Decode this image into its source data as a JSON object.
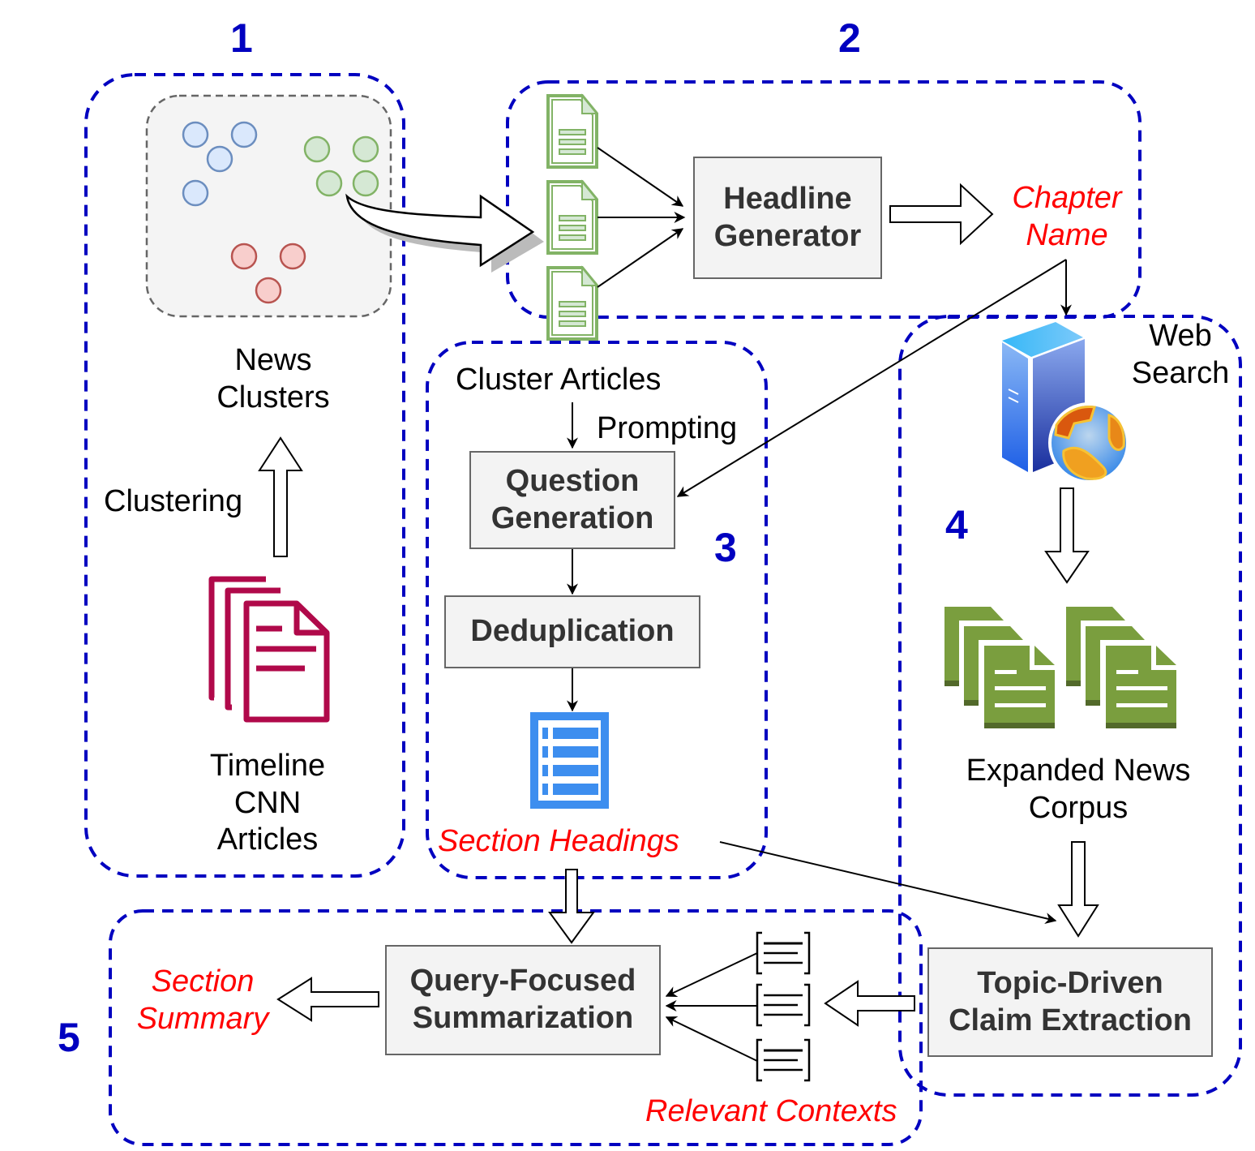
{
  "diagram": {
    "type": "pipeline-flowchart",
    "accent_colors": {
      "step_border": "#0000c0",
      "highlight_text": "#ff0000",
      "process_box_fill": "#f3f3f3",
      "process_box_border": "#666666",
      "cluster_blue": "#6c8ebf",
      "cluster_green": "#82b366",
      "cluster_red": "#b85450",
      "cnn_doc_icon": "#b0094a",
      "expanded_doc_icon": "#7a9e3e",
      "outline_icon": "#3d8eef"
    },
    "steps": [
      {
        "number": "1",
        "label": "News clustering"
      },
      {
        "number": "2",
        "label": "Chapter naming"
      },
      {
        "number": "3",
        "label": "Section heading generation"
      },
      {
        "number": "4",
        "label": "Web search expansion"
      },
      {
        "number": "5",
        "label": "Section summarization"
      }
    ],
    "step1": {
      "clusters_caption_line1": "News",
      "clusters_caption_line2": "Clusters",
      "clustering_label": "Clustering",
      "source_line1": "Timeline",
      "source_line2": "CNN",
      "source_line3": "Articles"
    },
    "step2": {
      "process_line1": "Headline",
      "process_line2": "Generator",
      "output_line1": "Chapter",
      "output_line2": "Name"
    },
    "step3": {
      "input_label": "Cluster Articles",
      "prompting_label": "Prompting",
      "process1_line1": "Question",
      "process1_line2": "Generation",
      "process2": "Deduplication",
      "output_label": "Section Headings"
    },
    "step4": {
      "web_search_line1": "Web",
      "web_search_line2": "Search",
      "corpus_line1": "Expanded News",
      "corpus_line2": "Corpus",
      "process_line1": "Topic-Driven",
      "process_line2": "Claim Extraction"
    },
    "step5": {
      "process_line1": "Query-Focused",
      "process_line2": "Summarization",
      "contexts_label": "Relevant Contexts",
      "output_line1": "Section",
      "output_line2": "Summary"
    }
  }
}
